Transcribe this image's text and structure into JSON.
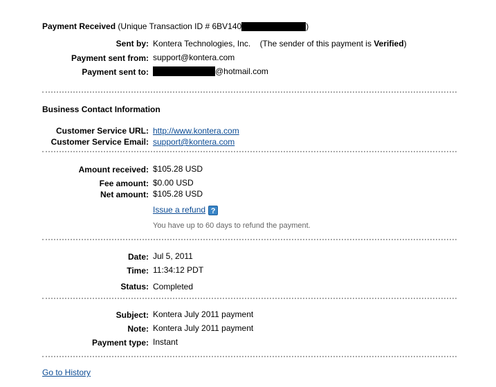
{
  "header": {
    "title": "Payment Received",
    "txn_prefix": "(Unique Transaction ID # 6BV140",
    "txn_suffix": ")"
  },
  "sender": {
    "sent_by_label": "Sent by:",
    "sent_by_value": "Kontera Technologies, Inc.",
    "verified_prefix": "(The sender of this payment is",
    "verified_word": "Verified",
    "verified_suffix": ")",
    "sent_from_label": "Payment sent from:",
    "sent_from_value": "support@kontera.com",
    "sent_to_label": "Payment sent to:",
    "sent_to_suffix": "@hotmail.com"
  },
  "business": {
    "heading": "Business Contact Information",
    "url_label": "Customer Service URL:",
    "url_value": "http://www.kontera.com",
    "email_label": "Customer Service Email:",
    "email_value": "support@kontera.com"
  },
  "amounts": {
    "received_label": "Amount received:",
    "received_value": "$105.28 USD",
    "fee_label": "Fee amount:",
    "fee_value": "$0.00 USD",
    "net_label": "Net amount:",
    "net_value": "$105.28 USD",
    "refund_link": "Issue a refund",
    "help_icon": "?",
    "refund_note": "You have up to 60 days to refund the payment."
  },
  "status": {
    "date_label": "Date:",
    "date_value": "Jul 5, 2011",
    "time_label": "Time:",
    "time_value": "11:34:12 PDT",
    "status_label": "Status:",
    "status_value": "Completed"
  },
  "details": {
    "subject_label": "Subject:",
    "subject_value": "Kontera July 2011 payment",
    "note_label": "Note:",
    "note_value": "Kontera July 2011 payment",
    "type_label": "Payment type:",
    "type_value": "Instant"
  },
  "footer": {
    "history_link": "Go to History"
  }
}
